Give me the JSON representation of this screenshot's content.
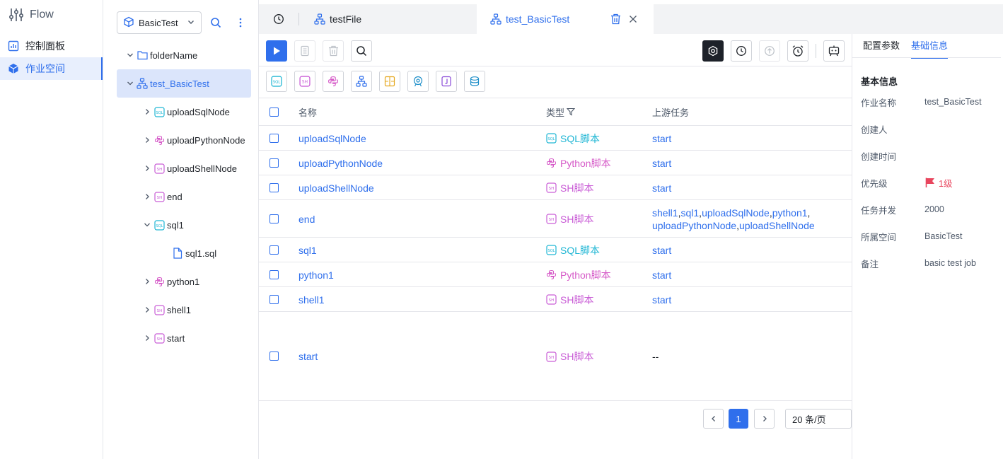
{
  "app": {
    "logo_text": "Flow"
  },
  "nav": {
    "items": [
      {
        "label": "控制面板",
        "icon": "dashboard-icon"
      },
      {
        "label": "作业空间",
        "icon": "cube-icon",
        "active": true
      }
    ]
  },
  "tree": {
    "workspace": "BasicTest",
    "nodes": [
      {
        "label": "folderName",
        "icon": "folder-icon"
      },
      {
        "label": "test_BasicTest",
        "icon": "workflow-icon",
        "selected": true
      },
      {
        "label": "uploadSqlNode",
        "icon": "sql-icon"
      },
      {
        "label": "uploadPythonNode",
        "icon": "python-icon"
      },
      {
        "label": "uploadShellNode",
        "icon": "shell-icon"
      },
      {
        "label": "end",
        "icon": "shell-icon"
      },
      {
        "label": "sql1",
        "icon": "sql-icon"
      },
      {
        "label": "sql1.sql",
        "icon": "file-icon"
      },
      {
        "label": "python1",
        "icon": "python-icon"
      },
      {
        "label": "shell1",
        "icon": "shell-icon"
      },
      {
        "label": "start",
        "icon": "shell-icon"
      }
    ]
  },
  "tabs": [
    {
      "label": "",
      "icon": "history-icon"
    },
    {
      "label": "testFile",
      "icon": "workflow-icon"
    },
    {
      "label": "test_BasicTest",
      "icon": "workflow-icon",
      "active": true
    }
  ],
  "table": {
    "headers": {
      "name": "名称",
      "type": "类型",
      "upstream": "上游任务"
    },
    "rows": [
      {
        "name": "uploadSqlNode",
        "type": "SQL脚本",
        "type_icon": "sql-icon",
        "type_color": "#1fb6d4",
        "upstream": [
          "start"
        ]
      },
      {
        "name": "uploadPythonNode",
        "type": "Python脚本",
        "type_icon": "python-icon",
        "type_color": "#d65bc8",
        "upstream": [
          "start"
        ]
      },
      {
        "name": "uploadShellNode",
        "type": "SH脚本",
        "type_icon": "shell-icon",
        "type_color": "#c95dd6",
        "upstream": [
          "start"
        ]
      },
      {
        "name": "end",
        "type": "SH脚本",
        "type_icon": "shell-icon",
        "type_color": "#c95dd6",
        "upstream": [
          "shell1",
          "sql1",
          "uploadSqlNode",
          "python1",
          "uploadPythonNode",
          "uploadShellNode"
        ]
      },
      {
        "name": "sql1",
        "type": "SQL脚本",
        "type_icon": "sql-icon",
        "type_color": "#1fb6d4",
        "upstream": [
          "start"
        ]
      },
      {
        "name": "python1",
        "type": "Python脚本",
        "type_icon": "python-icon",
        "type_color": "#d65bc8",
        "upstream": [
          "start"
        ]
      },
      {
        "name": "shell1",
        "type": "SH脚本",
        "type_icon": "shell-icon",
        "type_color": "#c95dd6",
        "upstream": [
          "start"
        ]
      },
      {
        "name": "start",
        "type": "SH脚本",
        "type_icon": "shell-icon",
        "type_color": "#c95dd6",
        "upstream_text": "--"
      }
    ]
  },
  "pagination": {
    "current": "1",
    "page_size": "20 条/页"
  },
  "right_panel": {
    "tabs": [
      "配置参数",
      "基础信息"
    ],
    "active_tab": "基础信息",
    "section_title": "基本信息",
    "fields": [
      {
        "label": "作业名称",
        "value": "test_BasicTest"
      },
      {
        "label": "创建人",
        "value": ""
      },
      {
        "label": "创建时间",
        "value": ""
      },
      {
        "label": "优先级",
        "value": "1级",
        "icon": "flag-icon"
      },
      {
        "label": "任务并发",
        "value": "2000"
      },
      {
        "label": "所属空间",
        "value": "BasicTest"
      },
      {
        "label": "备注",
        "value": "basic test job"
      }
    ]
  },
  "colors": {
    "accent": "#2f6fec",
    "sql": "#1fb6d4",
    "python": "#d65bc8",
    "shell": "#c95dd6",
    "priority": "#e8465e"
  }
}
